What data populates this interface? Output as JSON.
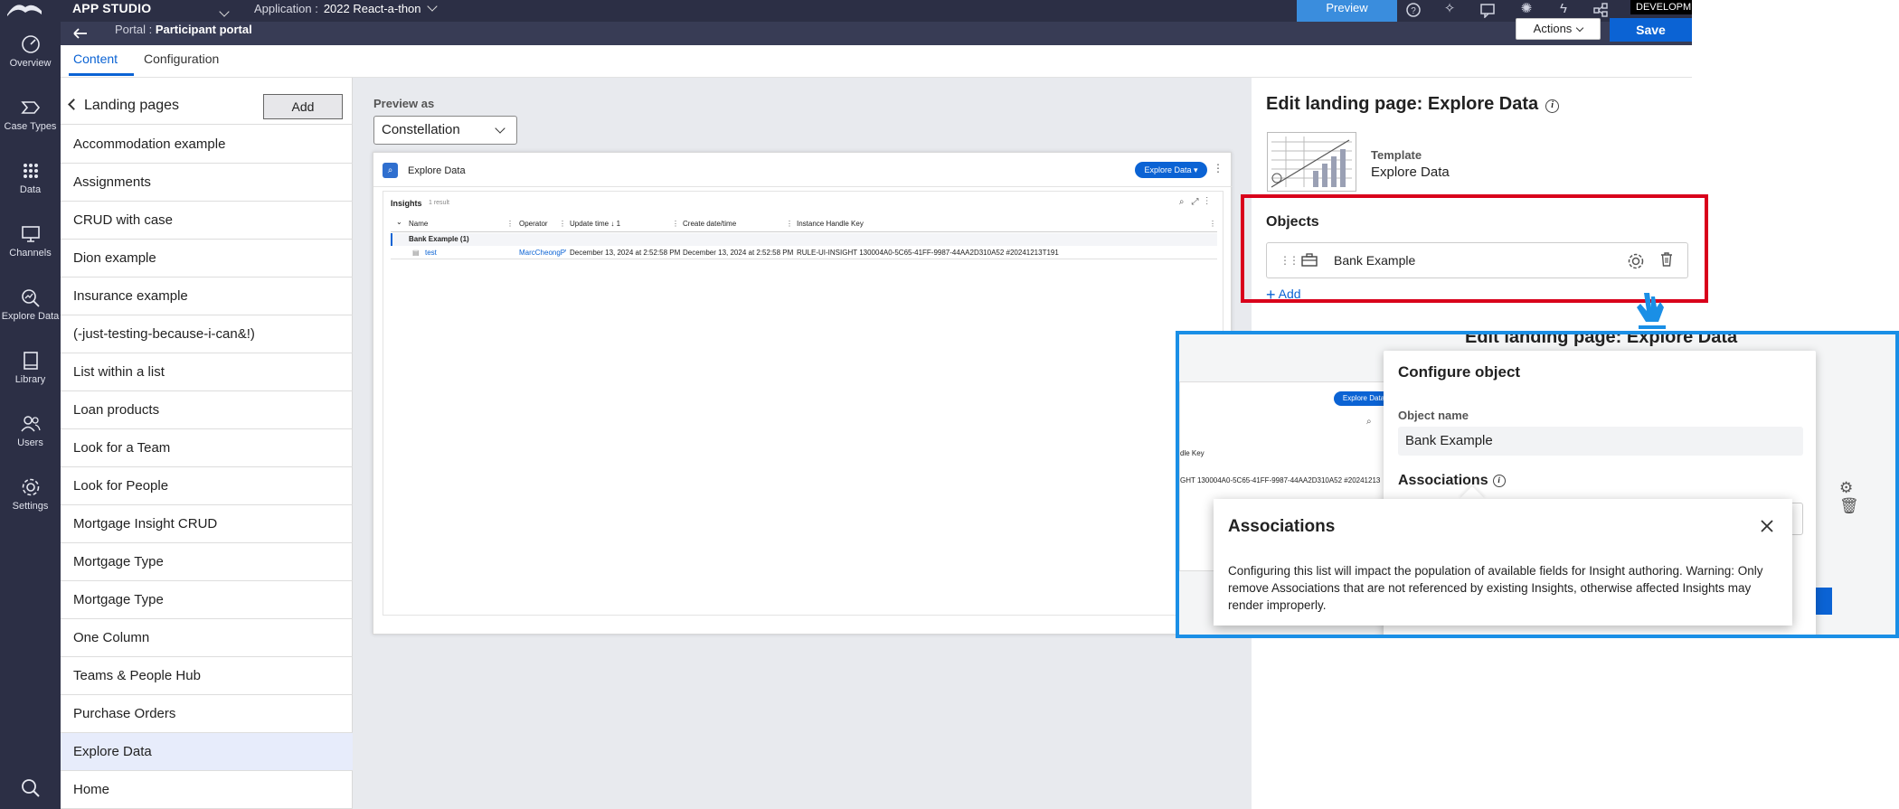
{
  "topbar": {
    "brand": "APP STUDIO",
    "application_label": "Application :",
    "application_value": "2022 React-a-thon",
    "preview_label": "Preview",
    "environment": "DEVELOPMENT",
    "icons": [
      "help-icon",
      "sparkle-icon",
      "chat-icon",
      "loading-icon",
      "bolt-icon",
      "share-icon"
    ]
  },
  "subbar": {
    "portal_label": "Portal :",
    "portal_value": "Participant portal",
    "actions_label": "Actions",
    "save_label": "Save"
  },
  "leftnav": {
    "items": [
      {
        "label": "Overview",
        "icon": "gauge-icon"
      },
      {
        "label": "Case Types",
        "icon": "case-type-icon"
      },
      {
        "label": "Data",
        "icon": "grid-icon"
      },
      {
        "label": "Channels",
        "icon": "monitor-icon"
      },
      {
        "label": "Explore Data",
        "icon": "explore-icon"
      },
      {
        "label": "Library",
        "icon": "book-icon"
      },
      {
        "label": "Users",
        "icon": "users-icon"
      },
      {
        "label": "Settings",
        "icon": "gear-icon"
      }
    ],
    "search_icon": "search-icon"
  },
  "tabs": {
    "content": "Content",
    "configuration": "Configuration"
  },
  "landing": {
    "title": "Landing pages",
    "add_label": "Add",
    "items": [
      "Accommodation example",
      "Assignments",
      "CRUD with case",
      "Dion example",
      "Insurance example",
      "(-just-testing-because-i-can&!)",
      "List within a list",
      "Loan products",
      "Look for a Team",
      "Look for People",
      "Mortgage Insight CRUD",
      "Mortgage Type",
      "Mortgage Type",
      "One Column",
      "Teams & People Hub",
      "Purchase Orders",
      "Explore Data",
      "Home"
    ],
    "selected_index": 16
  },
  "preview": {
    "label": "Preview as",
    "select_value": "Constellation",
    "frame_title": "Explore Data",
    "frame_button": "Explore Data ▾",
    "insights_label": "Insights",
    "insights_count": "1 result",
    "columns": [
      "Name",
      "Operator",
      "Update time ↓ 1",
      "Create date/time",
      "Instance Handle Key"
    ],
    "group_label": "Bank Example (1)",
    "row": {
      "name": "test",
      "operator": "MarcCheongPWuser",
      "update_time": "December 13, 2024 at 2:52:58 PM",
      "create_time": "December 13, 2024 at 2:52:58 PM",
      "key": "RULE-UI-INSIGHT 130004A0-5C65-41FF-9987-44AA2D310A52 #20241213T191"
    }
  },
  "edit": {
    "title": "Edit landing page: Explore Data",
    "template_label": "Template",
    "template_value": "Explore Data",
    "objects_title": "Objects",
    "object_name": "Bank Example",
    "add_label": "Add"
  },
  "callout": {
    "ghost_title": "Edit landing page: Explore Data",
    "ghost_button": "Explore Data",
    "ghost_key_header": "dle Key",
    "ghost_key_value": "GHT 130004A0-5C65-41FF-9987-44AA2D310A52 #20241213",
    "configure_title": "Configure object",
    "object_name_label": "Object name",
    "object_name_value": "Bank Example",
    "associations_label": "Associations",
    "tooltip_title": "Associations",
    "tooltip_body": "Configuring this list will impact the population of available fields for Insight authoring. Warning: Only remove Associations that are not referenced by existing Insights, otherwise affected Insights may render improperly."
  },
  "colors": {
    "nav_bg": "#2c2f45",
    "accent_blue": "#0b63d4",
    "highlight_red": "#d9001b",
    "callout_blue": "#1a8fe6"
  }
}
